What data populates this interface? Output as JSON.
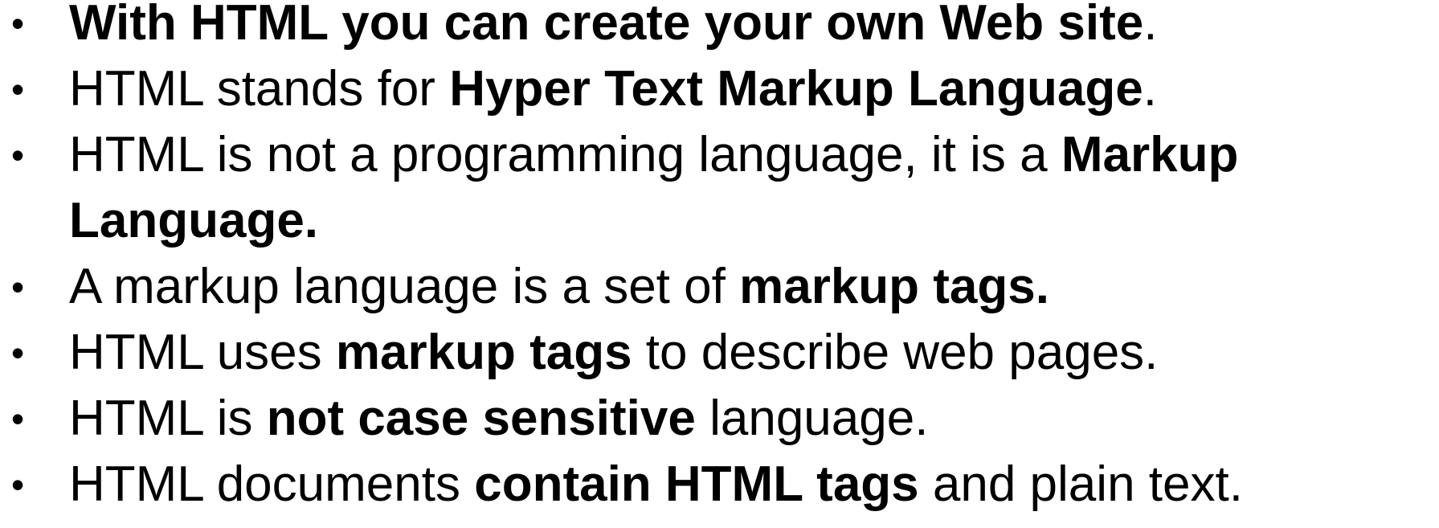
{
  "bullet_glyph": "•",
  "items": [
    {
      "b1": "With HTML you can create your own Web site",
      "t1": "."
    },
    {
      "t1": "HTML stands for ",
      "b1": "Hyper Text Markup Language",
      "t2": "."
    },
    {
      "t1": "HTML is not a programming language, it is a ",
      "b1": "Markup Language."
    },
    {
      "t1": "A markup language is a set of ",
      "b1": "markup tags."
    },
    {
      "t1": "HTML uses ",
      "b1": "markup tags",
      "t2": " to describe web pages."
    },
    {
      "t1": "HTML is ",
      "b1": "not case sensitive",
      "t2": " language."
    },
    {
      "t1": "HTML documents ",
      "b1": "contain HTML tags",
      "t2": " and plain text."
    }
  ]
}
